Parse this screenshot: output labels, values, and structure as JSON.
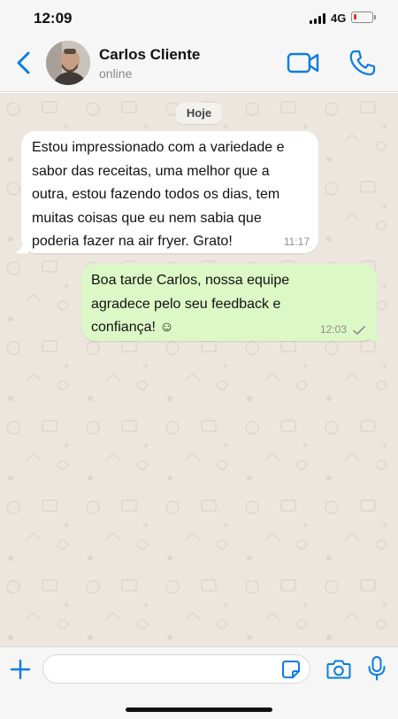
{
  "status_bar": {
    "time": "12:09",
    "network": "4G",
    "battery_level": 0.15,
    "battery_color": "#e0332d"
  },
  "header": {
    "contact_name": "Carlos Cliente",
    "contact_status": "online",
    "icons": [
      "chevron-left-icon",
      "video-camera-icon",
      "phone-icon"
    ],
    "accent_color": "#0b7de0"
  },
  "chat": {
    "date_label": "Hoje",
    "messages": [
      {
        "direction": "incoming",
        "text": "Estou impressionado com a variedade e\nsabor das receitas, uma melhor que a\noutra, estou fazendo todos os dias, tem\nmuitas coisas que eu nem sabia que\npoderia fazer na air fryer. Grato!",
        "time": "11:17"
      },
      {
        "direction": "outgoing",
        "text": "Boa tarde Carlos, nossa equipe\nagradece pelo seu feedback e\nconfiança! ☺",
        "time": "12:03",
        "status": "sent"
      }
    ]
  },
  "input_bar": {
    "placeholder": "",
    "icons": [
      "plus-icon",
      "sticker-icon",
      "camera-icon",
      "microphone-icon"
    ]
  }
}
